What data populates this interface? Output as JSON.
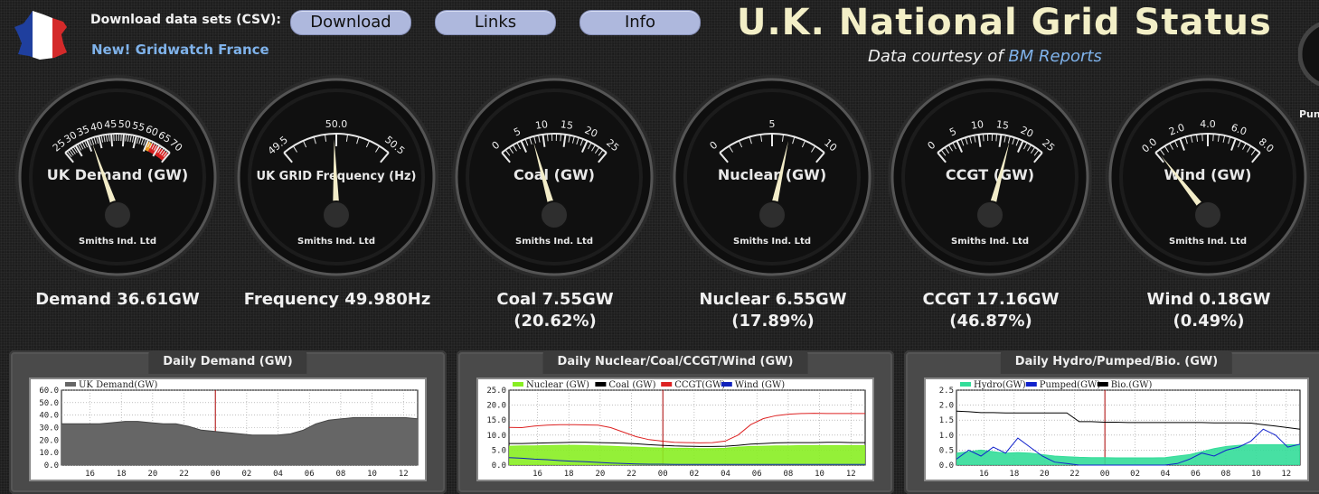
{
  "header": {
    "download_label": "Download data sets (CSV):",
    "france_link": "New! Gridwatch France",
    "buttons": [
      "Download",
      "Links",
      "Info"
    ],
    "title": "U.K. National Grid Status",
    "courtesy_prefix": "Data courtesy of",
    "courtesy_link": "BM Reports"
  },
  "gauges": [
    {
      "label": "UK Demand (GW)",
      "maker": "Smiths Ind. Ltd",
      "min": 25,
      "max": 70,
      "ticks": [
        "25",
        "30",
        "35",
        "40",
        "45",
        "50",
        "55",
        "60",
        "65",
        "70"
      ],
      "value": 36.61,
      "redzone": [
        60,
        70
      ]
    },
    {
      "label": "UK GRID Frequency (Hz)",
      "maker": "Smiths Ind. Ltd",
      "min": 49.5,
      "max": 50.5,
      "ticks": [
        "49.5",
        "50.0",
        "50.5"
      ],
      "value": 49.98
    },
    {
      "label": "Coal (GW)",
      "maker": "Smiths Ind. Ltd",
      "min": 0,
      "max": 25,
      "ticks": [
        "0",
        "5",
        "10",
        "15",
        "20",
        "25"
      ],
      "value": 7.55
    },
    {
      "label": "Nuclear (GW)",
      "maker": "Smiths Ind. Ltd",
      "min": 0,
      "max": 10,
      "ticks": [
        "0",
        "5",
        "10"
      ],
      "value": 6.55
    },
    {
      "label": "CCGT (GW)",
      "maker": "Smiths Ind. Ltd",
      "min": 0,
      "max": 25,
      "ticks": [
        "0",
        "5",
        "10",
        "15",
        "20",
        "25"
      ],
      "value": 17.16
    },
    {
      "label": "Wind (GW)",
      "maker": "Smiths Ind. Ltd",
      "min": 0,
      "max": 8,
      "ticks": [
        "0.0",
        "2.0",
        "4.0",
        "6.0",
        "8.0"
      ],
      "value": 0.18
    }
  ],
  "readouts": [
    {
      "line1": "Demand 36.61GW",
      "line2": ""
    },
    {
      "line1": "Frequency 49.980Hz",
      "line2": ""
    },
    {
      "line1": "Coal 7.55GW",
      "line2": "(20.62%)"
    },
    {
      "line1": "Nuclear 6.55GW",
      "line2": "(17.89%)"
    },
    {
      "line1": "CCGT 17.16GW",
      "line2": "(46.87%)"
    },
    {
      "line1": "Wind 0.18GW",
      "line2": "(0.49%)"
    }
  ],
  "side_gauge_label": "Pun",
  "panels": [
    {
      "title": "Daily Demand (GW)"
    },
    {
      "title": "Daily Nuclear/Coal/CCGT/Wind (GW)"
    },
    {
      "title": "Daily Hydro/Pumped/Bio. (GW)"
    }
  ],
  "chart_data": [
    {
      "type": "area",
      "title": "Daily Demand (GW)",
      "x_ticks": [
        "16",
        "18",
        "20",
        "22",
        "00",
        "02",
        "04",
        "06",
        "08",
        "10",
        "12"
      ],
      "ylim": [
        0,
        60
      ],
      "y_ticks": [
        "0.0",
        "10.0",
        "20.0",
        "30.0",
        "40.0",
        "50.0",
        "60.0"
      ],
      "series": [
        {
          "name": "UK Demand(GW)",
          "color": "#666666",
          "values": [
            33,
            33,
            33,
            33,
            34,
            35,
            35,
            34,
            33,
            33,
            31,
            28,
            27,
            26,
            25,
            24,
            24,
            24,
            25,
            28,
            33,
            36,
            37,
            38,
            38,
            38,
            38,
            38,
            37
          ]
        }
      ]
    },
    {
      "type": "line",
      "title": "Daily Nuclear/Coal/CCGT/Wind (GW)",
      "x_ticks": [
        "16",
        "18",
        "20",
        "22",
        "00",
        "02",
        "04",
        "06",
        "08",
        "10",
        "12"
      ],
      "ylim": [
        0,
        25
      ],
      "y_ticks": [
        "0.0",
        "5.0",
        "10.0",
        "15.0",
        "20.0",
        "25.0"
      ],
      "series": [
        {
          "name": "Nuclear (GW)",
          "color": "#88ee22",
          "fill": true,
          "values": [
            6.3,
            6.4,
            6.4,
            6.5,
            6.6,
            6.6,
            6.5,
            6.4,
            6.3,
            6.1,
            6.0,
            5.8,
            5.7,
            5.6,
            5.6,
            5.5,
            5.5,
            5.6,
            6.0,
            6.2,
            6.3,
            6.4,
            6.4,
            6.5,
            6.5,
            6.5,
            6.5,
            6.5,
            6.5
          ]
        },
        {
          "name": "Coal (GW)",
          "color": "#000000",
          "values": [
            7.2,
            7.2,
            7.3,
            7.4,
            7.5,
            7.6,
            7.6,
            7.5,
            7.4,
            7.3,
            7.1,
            6.8,
            6.6,
            6.4,
            6.3,
            6.2,
            6.2,
            6.3,
            6.6,
            7.0,
            7.2,
            7.4,
            7.5,
            7.5,
            7.5,
            7.6,
            7.6,
            7.5,
            7.5
          ]
        },
        {
          "name": "CCGT(GW)",
          "color": "#dd2222",
          "values": [
            12.6,
            12.5,
            13,
            13.3,
            13.5,
            13.5,
            13.4,
            13.3,
            12.5,
            11,
            9.5,
            8.5,
            8,
            7.6,
            7.5,
            7.4,
            7.5,
            8,
            10,
            13.5,
            15.5,
            16.5,
            17,
            17.2,
            17.3,
            17.2,
            17.2,
            17.2,
            17.2
          ]
        },
        {
          "name": "Wind (GW)",
          "color": "#1122bb",
          "values": [
            2.5,
            2.3,
            2.0,
            1.8,
            1.5,
            1.3,
            1.1,
            0.9,
            0.7,
            0.5,
            0.4,
            0.3,
            0.3,
            0.2,
            0.2,
            0.2,
            0.2,
            0.2,
            0.2,
            0.2,
            0.2,
            0.2,
            0.2,
            0.2,
            0.2,
            0.2,
            0.2,
            0.2,
            0.2
          ]
        }
      ]
    },
    {
      "type": "line",
      "title": "Daily Hydro/Pumped/Bio. (GW)",
      "x_ticks": [
        "16",
        "18",
        "20",
        "22",
        "00",
        "02",
        "04",
        "06",
        "08",
        "10",
        "12"
      ],
      "ylim": [
        0,
        2.5
      ],
      "y_ticks": [
        "0.0",
        "0.5",
        "1.0",
        "1.5",
        "2.0",
        "2.5"
      ],
      "series": [
        {
          "name": "Hydro(GW)",
          "color": "#33dd99",
          "fill": true,
          "values": [
            0.4,
            0.45,
            0.5,
            0.45,
            0.4,
            0.42,
            0.4,
            0.35,
            0.3,
            0.28,
            0.26,
            0.25,
            0.25,
            0.24,
            0.24,
            0.24,
            0.24,
            0.25,
            0.3,
            0.35,
            0.45,
            0.55,
            0.62,
            0.66,
            0.68,
            0.68,
            0.68,
            0.68,
            0.68
          ]
        },
        {
          "name": "Pumped(GW)",
          "color": "#1122cc",
          "values": [
            0.2,
            0.5,
            0.3,
            0.6,
            0.4,
            0.9,
            0.6,
            0.3,
            0.1,
            0.05,
            0,
            0,
            0,
            0,
            0,
            0,
            0,
            0,
            0.05,
            0.2,
            0.4,
            0.3,
            0.5,
            0.6,
            0.8,
            1.2,
            1.0,
            0.6,
            0.7
          ]
        },
        {
          "name": "Bio.(GW)",
          "color": "#000000",
          "values": [
            1.8,
            1.78,
            1.75,
            1.75,
            1.74,
            1.74,
            1.74,
            1.74,
            1.74,
            1.74,
            1.45,
            1.45,
            1.43,
            1.43,
            1.42,
            1.42,
            1.42,
            1.42,
            1.42,
            1.42,
            1.42,
            1.41,
            1.41,
            1.41,
            1.4,
            1.35,
            1.3,
            1.25,
            1.2
          ]
        }
      ]
    }
  ]
}
